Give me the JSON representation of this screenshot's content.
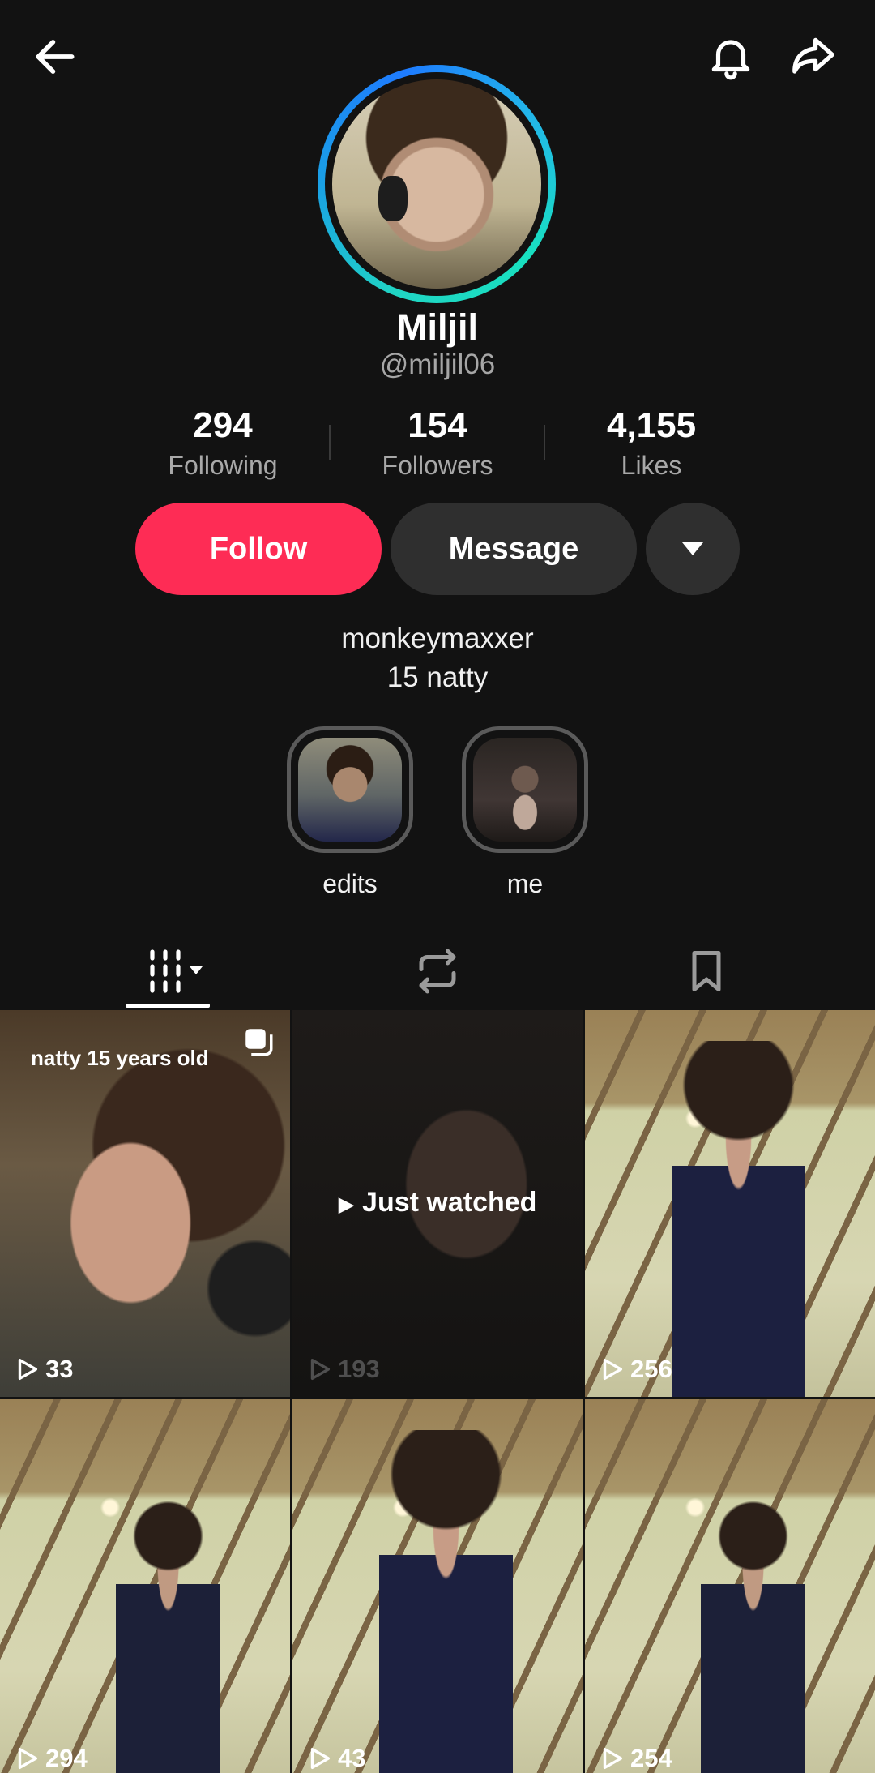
{
  "profile": {
    "display_name": "Miljil",
    "username": "@miljil06",
    "bio_line1": "monkeymaxxer",
    "bio_line2": "15 natty"
  },
  "stats": {
    "following": {
      "value": "294",
      "label": "Following"
    },
    "followers": {
      "value": "154",
      "label": "Followers"
    },
    "likes": {
      "value": "4,155",
      "label": "Likes"
    }
  },
  "actions": {
    "follow_label": "Follow",
    "message_label": "Message"
  },
  "highlights": [
    {
      "label": "edits"
    },
    {
      "label": "me"
    }
  ],
  "videos": [
    {
      "views": "33",
      "overlay": "natty 15 years old",
      "multi": true
    },
    {
      "views": "193",
      "status": "Just watched"
    },
    {
      "views": "256"
    },
    {
      "views": "294"
    },
    {
      "views": "43"
    },
    {
      "views": "254"
    }
  ],
  "colors": {
    "follow_button": "#fe2c55",
    "secondary_button": "#2f2f2f",
    "background": "#121212"
  },
  "icons": {
    "back": "back-arrow-icon",
    "notifications": "bell-icon",
    "share": "share-icon",
    "more": "caret-down-icon",
    "tab_videos": "grid-icon",
    "tab_reposts": "repost-icon",
    "tab_saved": "bookmark-icon"
  }
}
